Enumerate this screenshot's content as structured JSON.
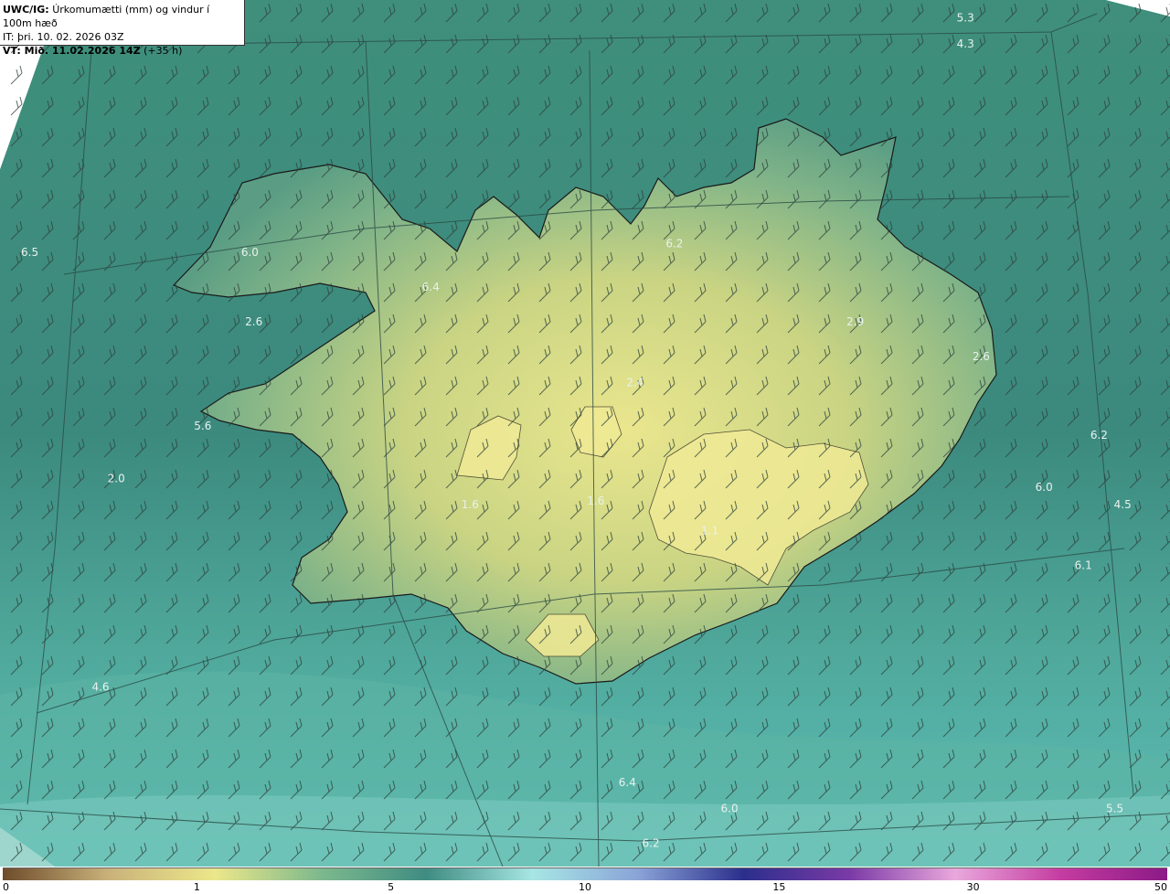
{
  "header": {
    "model": "UWC/IG:",
    "product": "Úrkomumætti (mm) og vindur í 100m hæð",
    "it_line": "IT: þri. 10. 02. 2026 03Z",
    "vt_label": "VT: Mið. 11.02.2026 14Z",
    "vt_lead": "(+35 h)"
  },
  "map_values": [
    {
      "label": "5.3",
      "lon": -13.5,
      "lat": 67.65
    },
    {
      "label": "4.3",
      "lon": -13.5,
      "lat": 67.5
    },
    {
      "label": "6.5",
      "lon": -25.4,
      "lat": 66.3
    },
    {
      "label": "6.0",
      "lon": -22.6,
      "lat": 66.3
    },
    {
      "label": "6.4",
      "lon": -20.3,
      "lat": 66.1
    },
    {
      "label": "6.2",
      "lon": -17.2,
      "lat": 66.35
    },
    {
      "label": "2.6",
      "lon": -22.55,
      "lat": 65.9
    },
    {
      "label": "2.9",
      "lon": -14.9,
      "lat": 65.9
    },
    {
      "label": "2.6",
      "lon": -13.3,
      "lat": 65.7
    },
    {
      "label": "2.4",
      "lon": -17.7,
      "lat": 65.55
    },
    {
      "label": "5.6",
      "lon": -23.2,
      "lat": 65.3
    },
    {
      "label": "6.2",
      "lon": -11.8,
      "lat": 65.25
    },
    {
      "label": "2.0",
      "lon": -24.3,
      "lat": 65.0
    },
    {
      "label": "1.6",
      "lon": -19.8,
      "lat": 64.85
    },
    {
      "label": "1.6",
      "lon": -18.2,
      "lat": 64.87
    },
    {
      "label": "6.0",
      "lon": -12.5,
      "lat": 64.95
    },
    {
      "label": "4.5",
      "lon": -11.5,
      "lat": 64.85
    },
    {
      "label": "1.1",
      "lon": -16.75,
      "lat": 64.7
    },
    {
      "label": "6.1",
      "lon": -12.0,
      "lat": 64.5
    },
    {
      "label": "4.6",
      "lon": -24.5,
      "lat": 63.8
    },
    {
      "label": "6.4",
      "lon": -17.8,
      "lat": 63.25
    },
    {
      "label": "6.0",
      "lon": -16.5,
      "lat": 63.1
    },
    {
      "label": "5.5",
      "lon": -11.6,
      "lat": 63.1
    },
    {
      "label": "6.2",
      "lon": -17.5,
      "lat": 62.9
    }
  ],
  "wind_barbs": {
    "speed_kt": 20,
    "direction_deg": 225
  },
  "colorbar": {
    "ticks": [
      "0",
      "1",
      "5",
      "10",
      "15",
      "30",
      "50"
    ],
    "colors": [
      "#6e4c2c",
      "#c9b27a",
      "#ece78a",
      "#7db98d",
      "#3f8c82",
      "#a7e6e4",
      "#8aa4d8",
      "#2b2f8c",
      "#7a3aa6",
      "#e9a8dc",
      "#c43ca0",
      "#8b1a86"
    ]
  },
  "colors": {
    "ocean": "#3d8a7c",
    "land_low": "#4f9a82",
    "land_high": "#e9e48a",
    "coast": "#1a1a1a",
    "gridline": "#2a4a45"
  }
}
